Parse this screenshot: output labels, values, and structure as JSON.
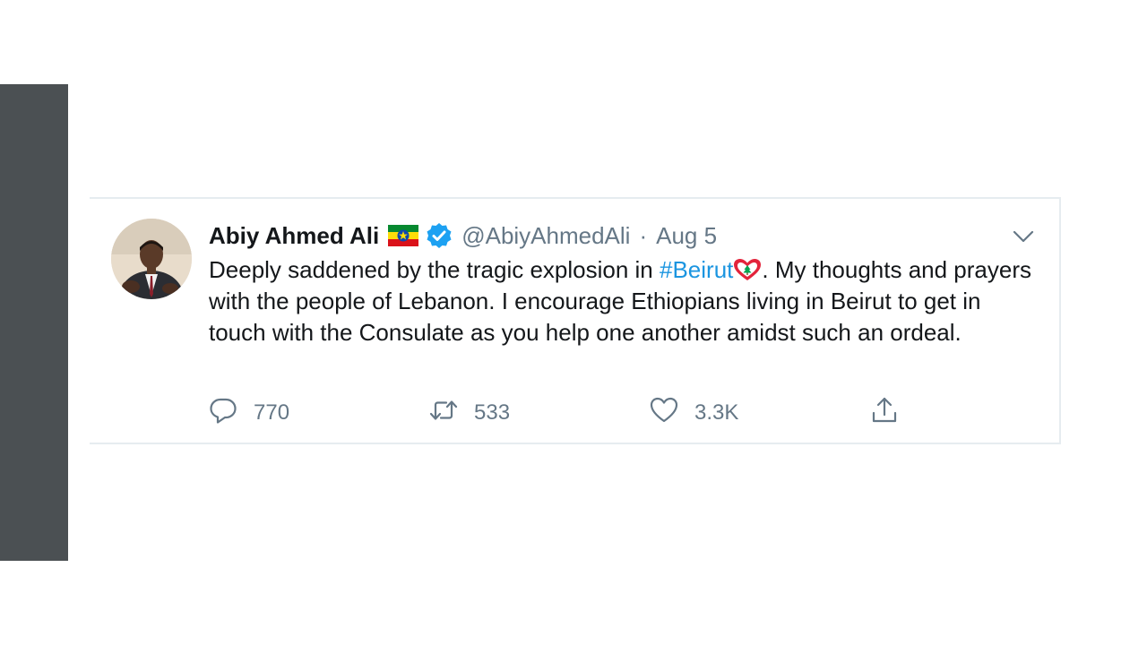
{
  "tweet": {
    "author_name": "Abiy Ahmed Ali",
    "handle": "@AbiyAhmedAli",
    "separator": "·",
    "date": "Aug 5",
    "text_part1": "Deeply saddened by the tragic explosion in ",
    "hashtag": "#Beirut",
    "text_part2": ". My thoughts and prayers with the people of Lebanon. I encourage Ethiopians living in Beirut to get in touch with the Consulate as you help one another amidst such an ordeal.",
    "reply_count": "770",
    "retweet_count": "533",
    "like_count": "3.3K"
  },
  "icons": {
    "flag": "ethiopia-flag-icon",
    "verified": "verified-badge-icon",
    "caret": "chevron-down-icon",
    "emoji": "lebanon-heart-emoji-icon",
    "reply": "reply-icon",
    "retweet": "retweet-icon",
    "like": "heart-icon",
    "share": "share-icon"
  },
  "colors": {
    "link": "#1b95e0",
    "muted": "#657786",
    "verified": "#1da1f2",
    "side_bar": "#4b5053"
  }
}
